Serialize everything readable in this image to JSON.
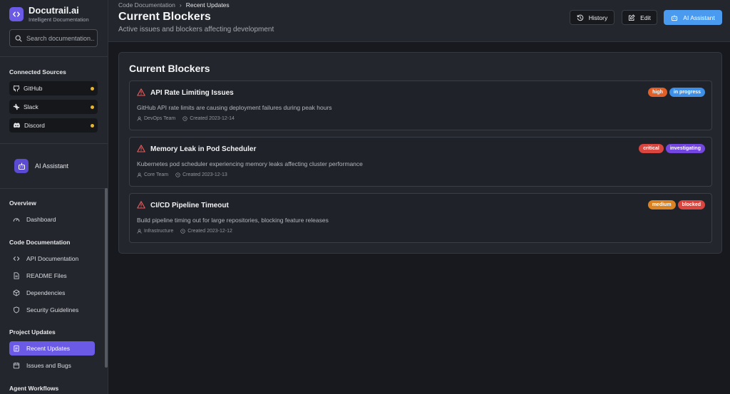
{
  "brand": {
    "name": "Docutrail.ai",
    "tagline": "Intelligent Documentation"
  },
  "search": {
    "placeholder": "Search documentation..."
  },
  "connected_sources": {
    "title": "Connected Sources",
    "items": [
      {
        "label": "GitHub",
        "icon": "github-icon",
        "status_color": "#e8b531"
      },
      {
        "label": "Slack",
        "icon": "slack-icon",
        "status_color": "#e8b531"
      },
      {
        "label": "Discord",
        "icon": "discord-icon",
        "status_color": "#e8b531"
      }
    ]
  },
  "sidebar_ai": {
    "label": "AI Assistant",
    "icon": "robot-icon"
  },
  "nav": {
    "overview": {
      "title": "Overview",
      "items": [
        {
          "label": "Dashboard",
          "icon": "gauge-icon"
        }
      ]
    },
    "code_docs": {
      "title": "Code Documentation",
      "items": [
        {
          "label": "API Documentation",
          "icon": "code-icon"
        },
        {
          "label": "README Files",
          "icon": "file-text-icon"
        },
        {
          "label": "Dependencies",
          "icon": "package-icon"
        },
        {
          "label": "Security Guidelines",
          "icon": "shield-icon"
        }
      ]
    },
    "project_updates": {
      "title": "Project Updates",
      "items": [
        {
          "label": "Recent Updates",
          "icon": "clipboard-icon",
          "active": true
        },
        {
          "label": "Issues and Bugs",
          "icon": "calendar-icon"
        }
      ]
    },
    "agent_workflows": {
      "title": "Agent Workflows"
    }
  },
  "header": {
    "breadcrumb": [
      "Code Documentation",
      "Recent Updates"
    ],
    "title": "Current Blockers",
    "subtitle": "Active issues and blockers affecting development",
    "buttons": {
      "history": "History",
      "edit": "Edit",
      "ai": "AI Assistant"
    }
  },
  "panel": {
    "title": "Current Blockers",
    "blockers": [
      {
        "title": "API Rate Limiting Issues",
        "description": "GitHub API rate limits are causing deployment failures during peak hours",
        "team": "DevOps Team",
        "created": "Created 2023-12-14",
        "priority": {
          "label": "high",
          "color": "#e0602a"
        },
        "status": {
          "label": "in progress",
          "color": "#3d8fe8"
        }
      },
      {
        "title": "Memory Leak in Pod Scheduler",
        "description": "Kubernetes pod scheduler experiencing memory leaks affecting cluster performance",
        "team": "Core Team",
        "created": "Created 2023-12-13",
        "priority": {
          "label": "critical",
          "color": "#d9453f"
        },
        "status": {
          "label": "investigating",
          "color": "#7446e0"
        }
      },
      {
        "title": "CI/CD Pipeline Timeout",
        "description": "Build pipeline timing out for large repositories, blocking feature releases",
        "team": "Infrastructure",
        "created": "Created 2023-12-12",
        "priority": {
          "label": "medium",
          "color": "#d98325"
        },
        "status": {
          "label": "blocked",
          "color": "#d9453f"
        }
      }
    ]
  },
  "colors": {
    "accent": "#6a5ae6",
    "primary_button": "#4a9af0",
    "warning_icon": "#ef5b5b"
  }
}
